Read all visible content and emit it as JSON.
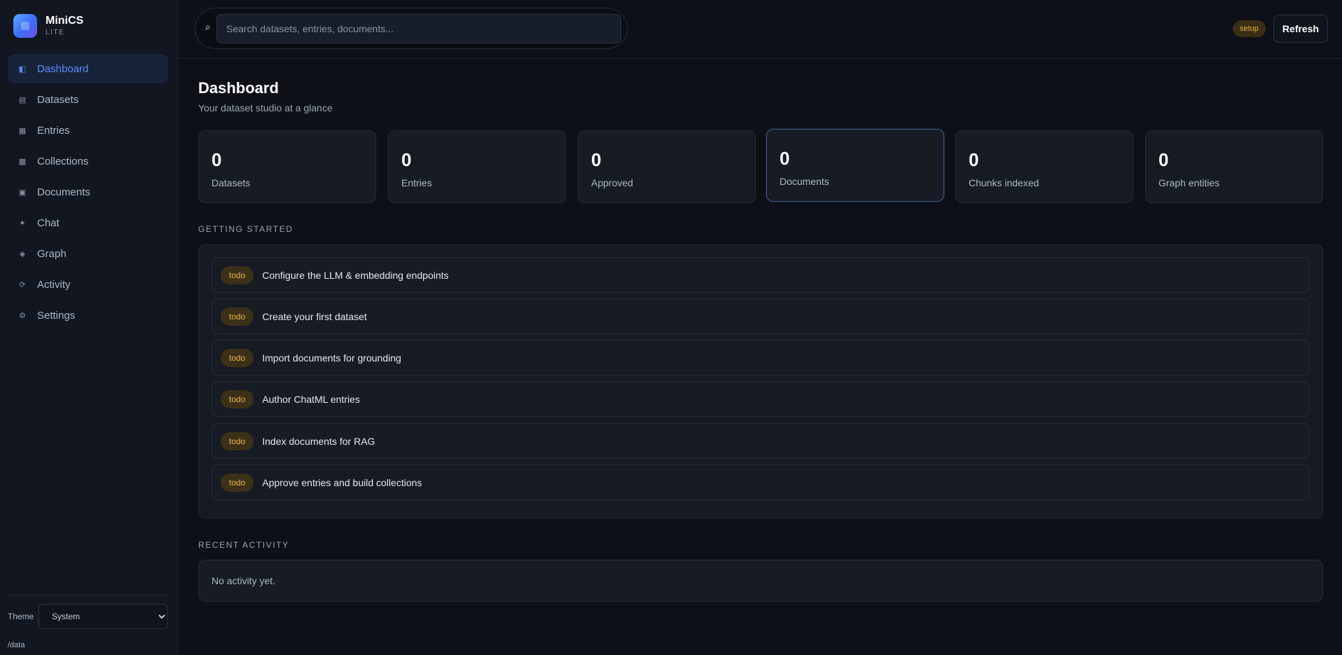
{
  "brand": {
    "name": "MiniCS",
    "sub": "LITE"
  },
  "sidebar": {
    "items": [
      {
        "label": "Dashboard",
        "icon": "dashboard-icon",
        "glyph": "◧",
        "active": true
      },
      {
        "label": "Datasets",
        "icon": "datasets-icon",
        "glyph": "▤",
        "active": false
      },
      {
        "label": "Entries",
        "icon": "entries-icon",
        "glyph": "▦",
        "active": false
      },
      {
        "label": "Collections",
        "icon": "collections-icon",
        "glyph": "▩",
        "active": false
      },
      {
        "label": "Documents",
        "icon": "documents-icon",
        "glyph": "▣",
        "active": false
      },
      {
        "label": "Chat",
        "icon": "chat-icon",
        "glyph": "✦",
        "active": false
      },
      {
        "label": "Graph",
        "icon": "graph-icon",
        "glyph": "◈",
        "active": false
      },
      {
        "label": "Activity",
        "icon": "activity-icon",
        "glyph": "⟳",
        "active": false
      },
      {
        "label": "Settings",
        "icon": "settings-icon",
        "glyph": "⚙",
        "active": false
      }
    ],
    "theme_label": "Theme",
    "theme_value": "System",
    "data_path": "/data"
  },
  "topbar": {
    "search_glyph": "⌕",
    "search_placeholder": "Search datasets, entries, documents...",
    "setup_badge": "setup",
    "refresh_label": "Refresh"
  },
  "page": {
    "title": "Dashboard",
    "subtitle": "Your dataset studio at a glance"
  },
  "stats": [
    {
      "value": "0",
      "label": "Datasets"
    },
    {
      "value": "0",
      "label": "Entries"
    },
    {
      "value": "0",
      "label": "Approved"
    },
    {
      "value": "0",
      "label": "Documents",
      "highlight": true
    },
    {
      "value": "0",
      "label": "Chunks indexed"
    },
    {
      "value": "0",
      "label": "Graph entities"
    }
  ],
  "getting_started": {
    "heading": "GETTING STARTED",
    "tasks": [
      {
        "status": "todo",
        "text": "Configure the LLM & embedding endpoints"
      },
      {
        "status": "todo",
        "text": "Create your first dataset"
      },
      {
        "status": "todo",
        "text": "Import documents for grounding"
      },
      {
        "status": "todo",
        "text": "Author ChatML entries"
      },
      {
        "status": "todo",
        "text": "Index documents for RAG"
      },
      {
        "status": "todo",
        "text": "Approve entries and build collections"
      }
    ]
  },
  "recent_activity": {
    "heading": "RECENT ACTIVITY",
    "empty_text": "No activity yet."
  },
  "colors": {
    "accent": "#5b8cff",
    "background": "#0d1117",
    "badge_amber": "#e8b545"
  }
}
